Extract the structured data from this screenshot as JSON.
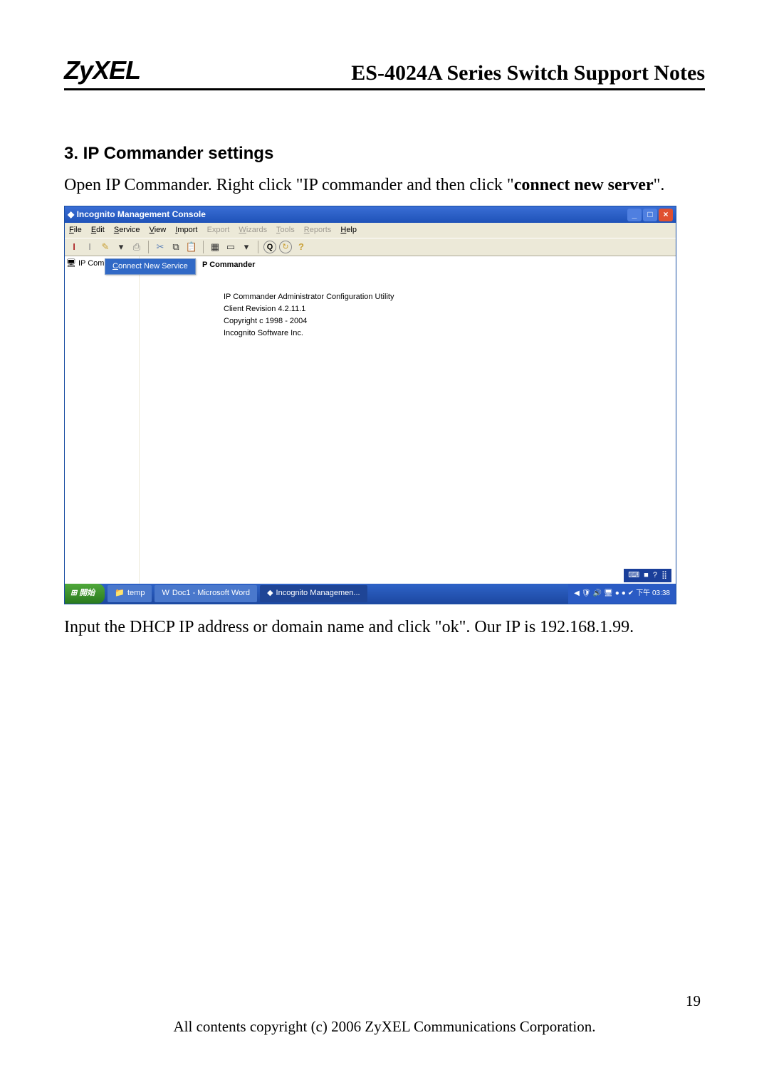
{
  "header": {
    "logo": "ZyXEL",
    "title": "ES-4024A Series Switch Support Notes"
  },
  "section": {
    "heading": "3. IP Commander settings",
    "p1a": "Open IP Commander. Right click \"IP commander and then click \"",
    "p1b": "connect new server",
    "p1c": "\".",
    "p2": "Input the DHCP IP address or domain name and click \"ok\". Our IP is 192.168.1.99."
  },
  "app": {
    "title": "Incognito Management Console",
    "menu": {
      "file": "File",
      "edit": "Edit",
      "service": "Service",
      "view": "View",
      "import": "Import",
      "export": "Export",
      "wizards": "Wizards",
      "tools": "Tools",
      "reports": "Reports",
      "help": "Help"
    },
    "tree": {
      "root": "IP Commander"
    },
    "context": {
      "connect": "Connect New Service"
    },
    "content": {
      "title": "P Commander",
      "l1": "IP Commander Administrator Configuration Utility",
      "l2": "Client Revision 4.2.11.1",
      "l3": "Copyright c 1998 - 2004",
      "l4": "Incognito Software Inc."
    },
    "langbar": {
      "kb": "■",
      "help": "?"
    },
    "taskbar": {
      "start": "開始",
      "btn1": "temp",
      "btn2": "Doc1 - Microsoft Word",
      "btn3": "Incognito Managemen...",
      "time": "下午 03:38"
    }
  },
  "footer": {
    "copyright": "All contents copyright (c) 2006 ZyXEL Communications Corporation.",
    "page": "19"
  }
}
